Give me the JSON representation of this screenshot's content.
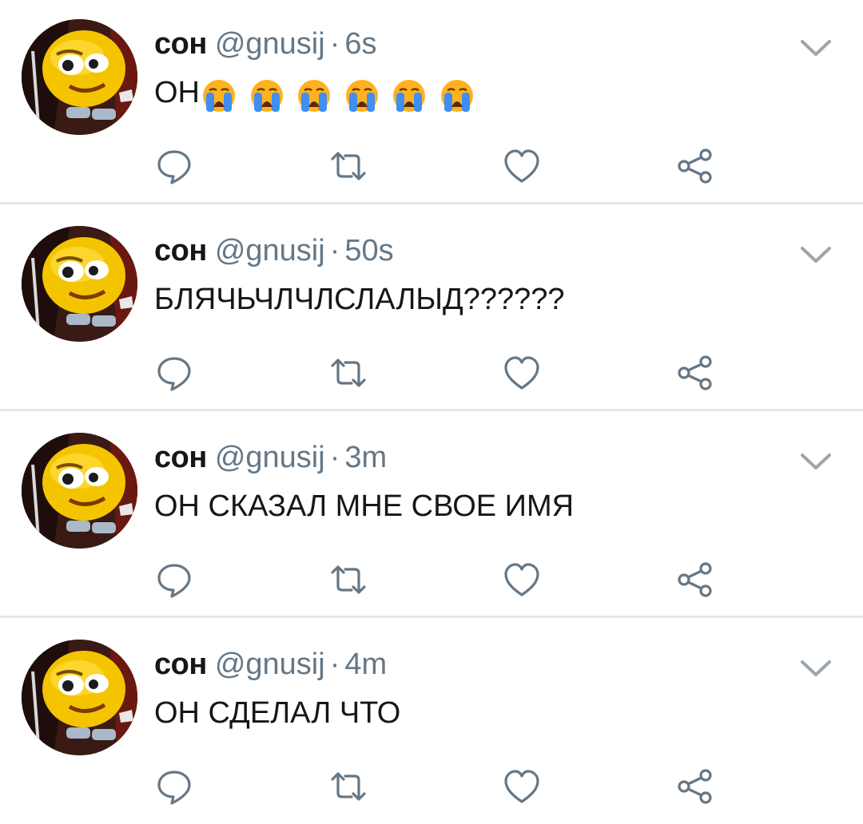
{
  "tweets": [
    {
      "name": "сон",
      "handle": "@gnusij",
      "separator": "·",
      "time": "6s",
      "text": "ОН",
      "emoji": "loudly-crying-face-emoji",
      "emoji_count": 6
    },
    {
      "name": "сон",
      "handle": "@gnusij",
      "separator": "·",
      "time": "50s",
      "text": "БЛЯЧЬЧЛЧЛСЛАЛЫД??????"
    },
    {
      "name": "сон",
      "handle": "@gnusij",
      "separator": "·",
      "time": "3m",
      "text": "ОН СКАЗАЛ МНЕ СВОЕ ИМЯ"
    },
    {
      "name": "сон",
      "handle": "@gnusij",
      "separator": "·",
      "time": "4m",
      "text": "ОН СДЕЛАЛ ЧТО"
    }
  ],
  "icons": {
    "caret": "chevron-down-icon",
    "reply": "reply-icon",
    "retweet": "retweet-icon",
    "like": "heart-icon",
    "share": "share-icon"
  },
  "colors": {
    "name": "#14171a",
    "secondary": "#657786",
    "icon": "#657786",
    "divider": "#e3e7ea",
    "background": "#ffffff"
  }
}
